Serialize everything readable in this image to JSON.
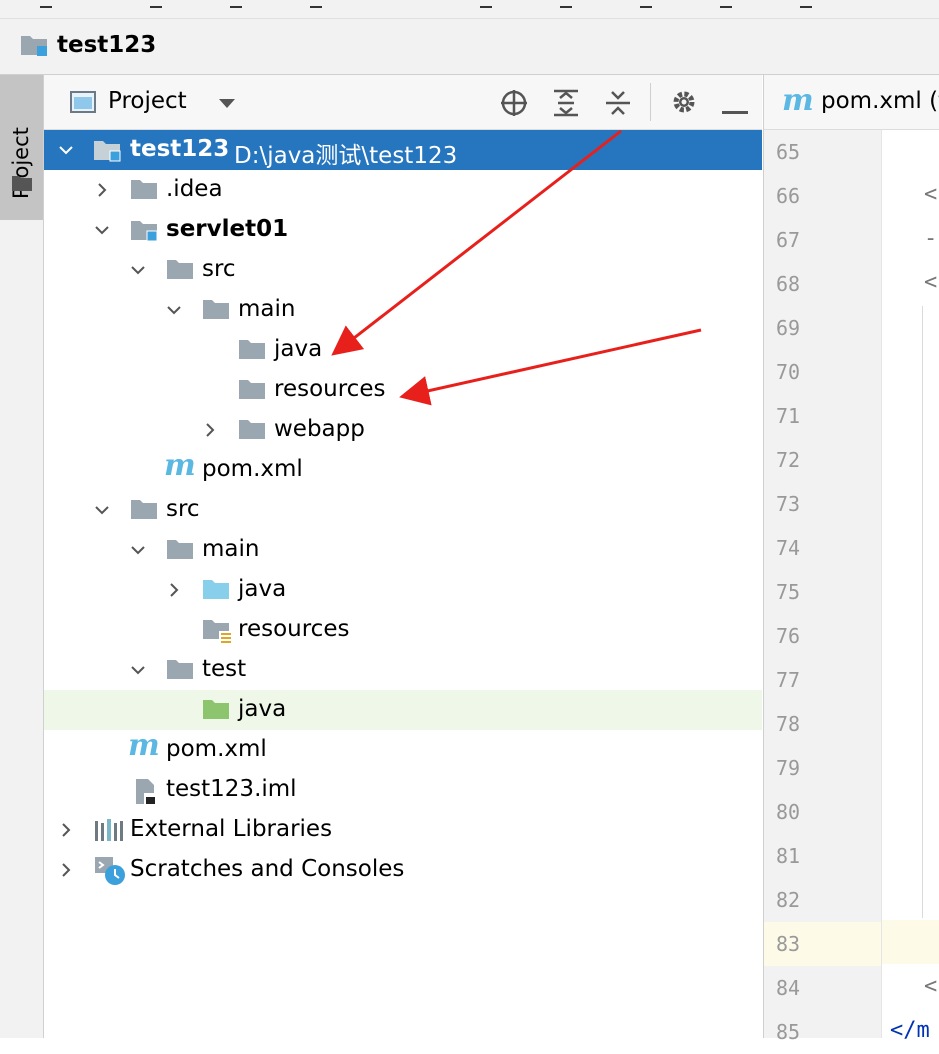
{
  "titlebar": {
    "title": "test123"
  },
  "side_strip": {
    "tab_label": "Project"
  },
  "panel": {
    "title": "Project",
    "toolbar": [
      "locate-icon",
      "expand-all-icon",
      "collapse-all-icon",
      "gear-icon",
      "minimize-icon"
    ]
  },
  "tree": [
    {
      "label": "test123",
      "path": "D:\\java测试\\test123",
      "bold": true,
      "selected": true
    },
    {
      "label": ".idea"
    },
    {
      "label": "servlet01",
      "bold": true
    },
    {
      "label": "src"
    },
    {
      "label": "main"
    },
    {
      "label": "java"
    },
    {
      "label": "resources"
    },
    {
      "label": "webapp"
    },
    {
      "label": "pom.xml"
    },
    {
      "label": "src"
    },
    {
      "label": "main"
    },
    {
      "label": "java"
    },
    {
      "label": "resources"
    },
    {
      "label": "test"
    },
    {
      "label": "java"
    },
    {
      "label": "pom.xml"
    },
    {
      "label": "test123.iml"
    },
    {
      "label": "External Libraries"
    },
    {
      "label": "Scratches and Consoles"
    }
  ],
  "editor": {
    "tab_label": "pom.xml (t",
    "line_numbers": [
      "65",
      "66",
      "67",
      "68",
      "69",
      "70",
      "71",
      "72",
      "73",
      "74",
      "75",
      "76",
      "77",
      "78",
      "79",
      "80",
      "81",
      "82",
      "83",
      "84",
      "85"
    ],
    "code_fragments": [
      "<",
      "-",
      "<",
      "<",
      "</m"
    ],
    "current_line": "83"
  },
  "colors": {
    "selection": "#2675bf",
    "annotation_arrow": "#e8201c",
    "maven_m": "#5ab8e3",
    "source_folder": "#87cfea",
    "test_folder": "#8cc56e"
  }
}
